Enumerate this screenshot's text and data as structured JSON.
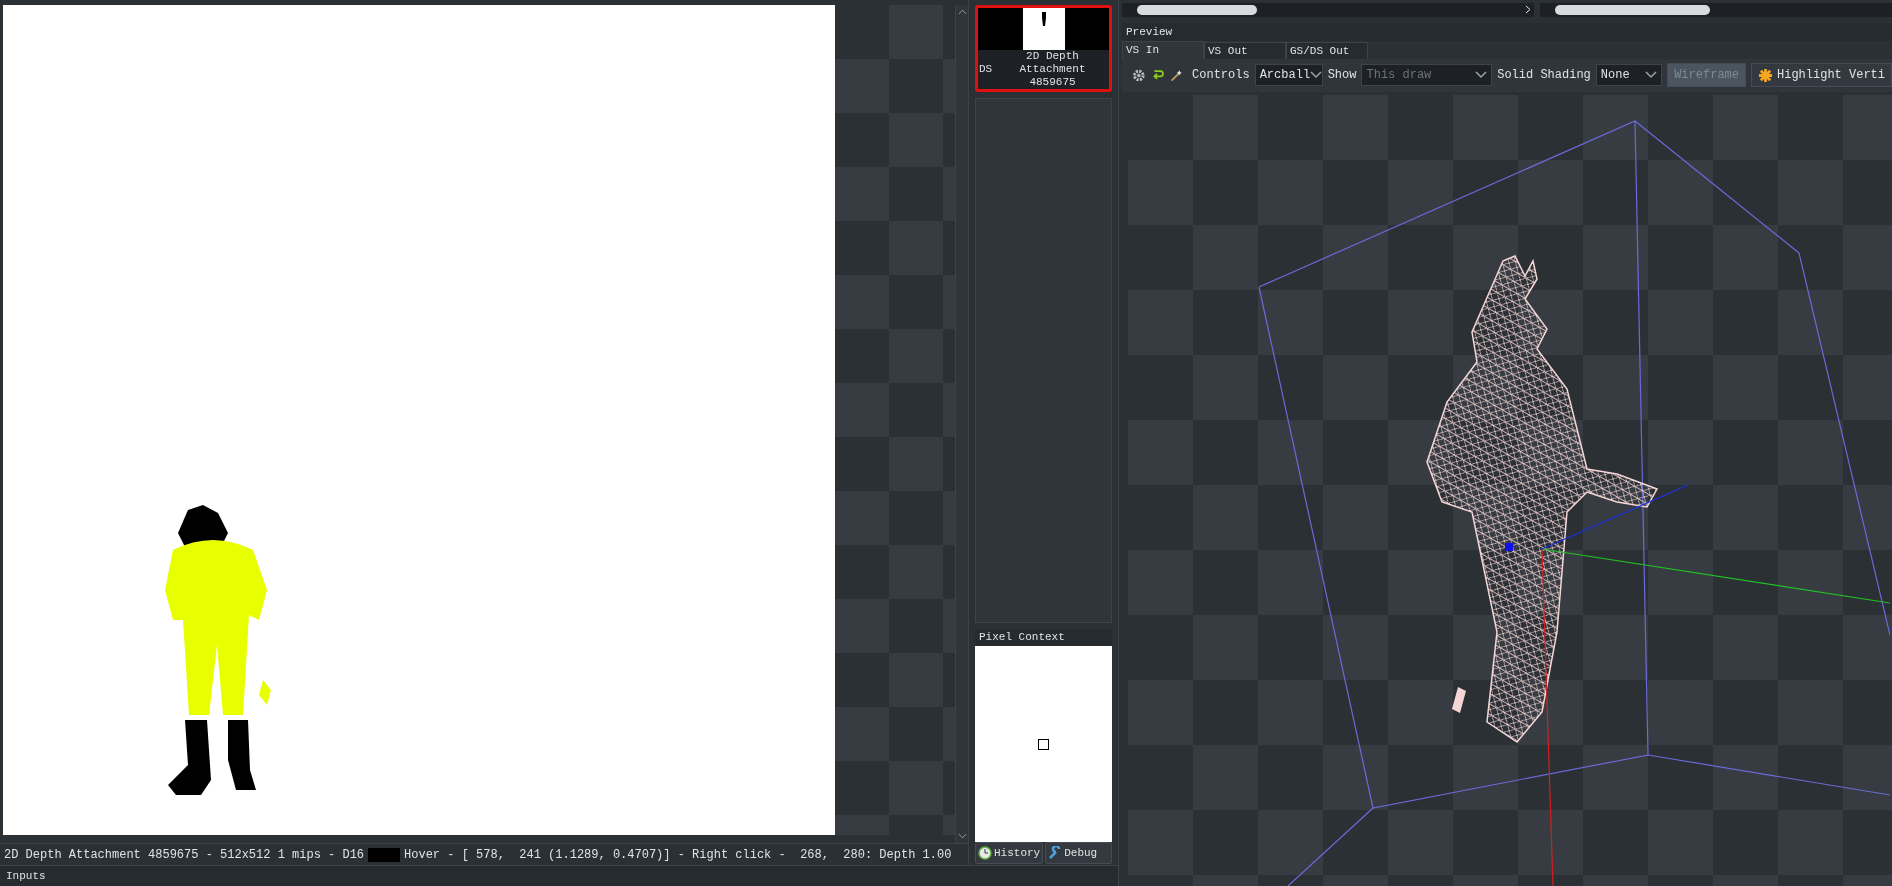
{
  "texture_viewer": {
    "status": {
      "info": "2D Depth Attachment 4859675 - 512x512 1 mips - D16",
      "hover": "Hover - [ 578,  241 (1.1289, 0.4707)] - Right click -  268,  280: Depth 1.00"
    }
  },
  "thumbnail": {
    "slot": "DS",
    "label_lines": [
      "2D Depth",
      "Attachment",
      "4859675"
    ],
    "selected": true
  },
  "pixel_context": {
    "title": "Pixel Context",
    "buttons": [
      {
        "label": "History",
        "kind": "history"
      },
      {
        "label": "Debug",
        "kind": "debug"
      }
    ]
  },
  "inputs_bar": {
    "title": "Inputs"
  },
  "mesh_preview": {
    "title": "Preview",
    "tabs": [
      {
        "label": "VS In",
        "selected": true
      },
      {
        "label": "VS Out",
        "selected": false
      },
      {
        "label": "GS/DS Out",
        "selected": false
      }
    ],
    "controls": {
      "label": "Controls",
      "value": "Arcball"
    },
    "show": {
      "label": "Show",
      "value": "This draw",
      "disabled": true
    },
    "solid_shading": {
      "label": "Solid Shading",
      "value": "None"
    },
    "buttons": [
      {
        "label": "Wireframe",
        "kind": "plain",
        "disabled": true
      },
      {
        "label": "Highlight Verti",
        "kind": "highlight",
        "disabled": false
      }
    ]
  }
}
